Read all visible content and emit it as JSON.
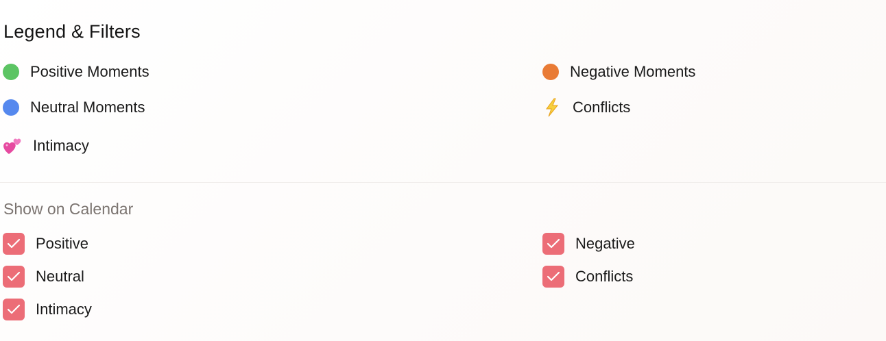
{
  "legend": {
    "title": "Legend & Filters",
    "items": [
      {
        "label": "Positive Moments",
        "color": "#5cc463"
      },
      {
        "label": "Negative Moments",
        "color": "#e97b35"
      },
      {
        "label": "Neutral Moments",
        "color": "#5588ee"
      },
      {
        "label": "Conflicts",
        "icon": "lightning-icon",
        "color": "#f2c230"
      },
      {
        "label": "Intimacy",
        "icon": "two-hearts-icon",
        "color": "#e64aa0"
      }
    ]
  },
  "filters": {
    "heading": "Show on Calendar",
    "checkbox_color": "#ec6d77",
    "items": [
      {
        "label": "Positive",
        "checked": true
      },
      {
        "label": "Negative",
        "checked": true
      },
      {
        "label": "Neutral",
        "checked": true
      },
      {
        "label": "Conflicts",
        "checked": true
      },
      {
        "label": "Intimacy",
        "checked": true
      }
    ]
  }
}
